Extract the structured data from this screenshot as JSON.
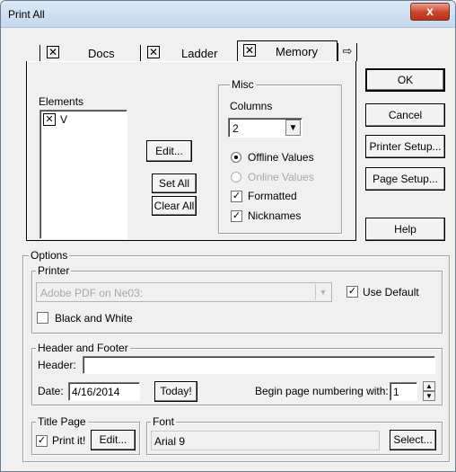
{
  "window": {
    "title": "Print All",
    "close_glyph": "x"
  },
  "tabs": [
    {
      "label": "Docs",
      "checked": true
    },
    {
      "label": "Ladder",
      "checked": true
    },
    {
      "label": "Memory",
      "checked": true
    }
  ],
  "tab_scroll_icon": "arrow-right-icon",
  "elements": {
    "label": "Elements",
    "items": [
      {
        "label": "V",
        "checked": true
      }
    ],
    "edit_button": "Edit...",
    "set_all_button": "Set All",
    "clear_all_button": "Clear All"
  },
  "misc": {
    "label": "Misc",
    "columns_label": "Columns",
    "columns_value": "2",
    "offline_values": "Offline Values",
    "online_values": "Online Values",
    "formatted": "Formatted",
    "nicknames": "Nicknames"
  },
  "side_buttons": {
    "ok": "OK",
    "cancel": "Cancel",
    "printer_setup": "Printer Setup...",
    "page_setup": "Page Setup...",
    "help": "Help"
  },
  "options": {
    "label": "Options",
    "printer": {
      "label": "Printer",
      "selected": "Adobe PDF on Ne03:",
      "use_default": "Use Default",
      "black_white": "Black and White"
    },
    "header_footer": {
      "label": "Header and Footer",
      "header_label": "Header:",
      "header_value": "",
      "date_label": "Date:",
      "date_value": "4/16/2014",
      "today_button": "Today!",
      "begin_label": "Begin page numbering with:",
      "begin_value": "1"
    },
    "title_page": {
      "label": "Title Page",
      "print_it": "Print it!",
      "edit_button": "Edit..."
    },
    "font": {
      "label": "Font",
      "value": "Arial 9",
      "select_button": "Select..."
    }
  }
}
